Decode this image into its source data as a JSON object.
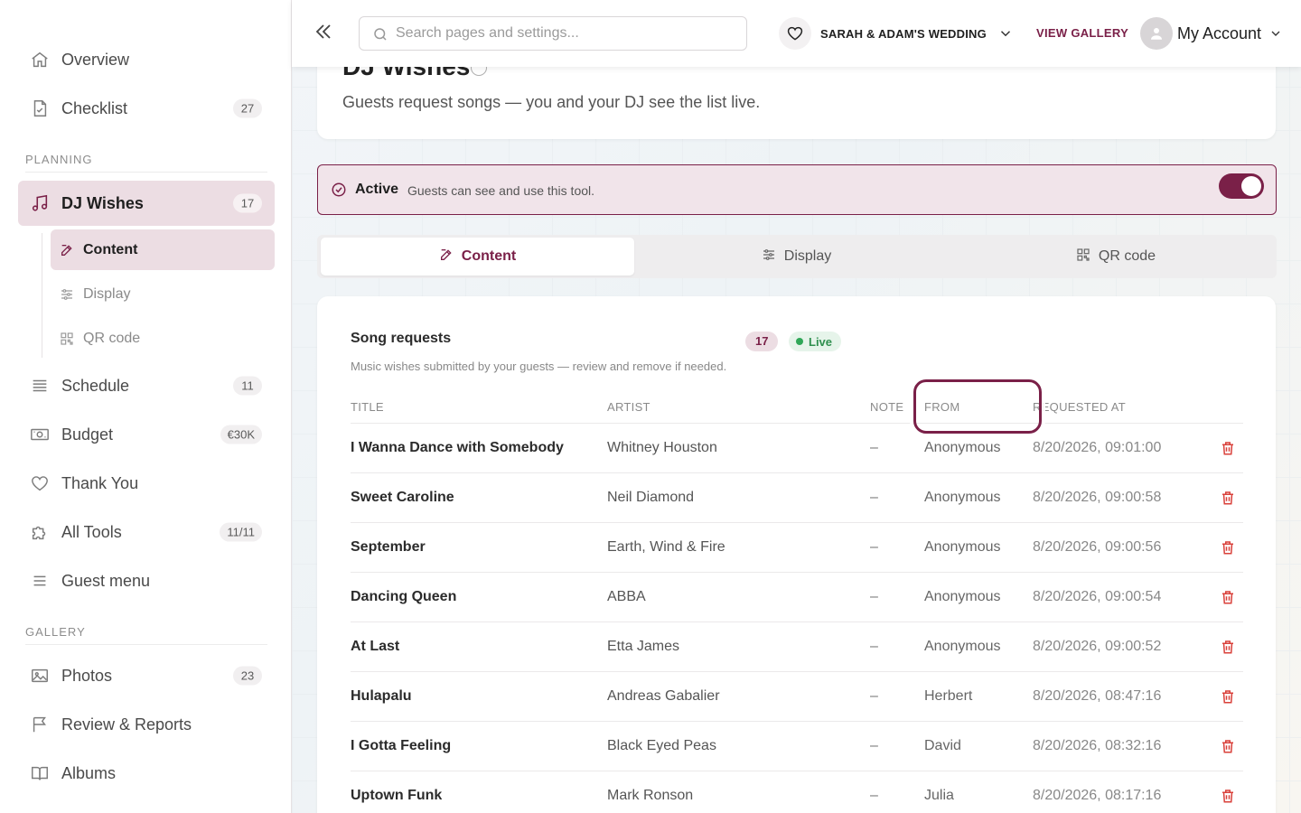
{
  "sidebar": {
    "items_top": [
      {
        "label": "Overview",
        "icon": "home-icon",
        "badge": ""
      },
      {
        "label": "Checklist",
        "icon": "checklist-icon",
        "badge": "27"
      }
    ],
    "planning_label": "PLANNING",
    "dj": {
      "label": "DJ Wishes",
      "icon": "music-note-icon",
      "badge": "17"
    },
    "sub_items": [
      {
        "label": "Content",
        "icon": "edit-icon"
      },
      {
        "label": "Display",
        "icon": "sliders-icon"
      },
      {
        "label": "QR code",
        "icon": "qr-code-icon"
      }
    ],
    "items_mid": [
      {
        "label": "Schedule",
        "icon": "list-icon",
        "badge": "11"
      },
      {
        "label": "Budget",
        "icon": "money-icon",
        "badge": "€30K"
      },
      {
        "label": "Thank You",
        "icon": "heart-icon",
        "badge": ""
      },
      {
        "label": "All Tools",
        "icon": "puzzle-icon",
        "badge": "11/11"
      },
      {
        "label": "Guest menu",
        "icon": "menu-icon",
        "badge": ""
      }
    ],
    "gallery_label": "GALLERY",
    "items_gallery": [
      {
        "label": "Photos",
        "icon": "photo-icon",
        "badge": "23"
      },
      {
        "label": "Review & Reports",
        "icon": "flag-icon",
        "badge": ""
      },
      {
        "label": "Albums",
        "icon": "book-icon",
        "badge": ""
      }
    ]
  },
  "topbar": {
    "search_placeholder": "Search pages and settings...",
    "event_name": "SARAH & ADAM'S WEDDING",
    "view_gallery": "VIEW GALLERY",
    "account": "My Account"
  },
  "header": {
    "title": "DJ Wishes",
    "subtitle": "Guests request songs — you and your DJ see the list live."
  },
  "status": {
    "state": "Active",
    "description": "Guests can see and use this tool.",
    "toggle_on": true
  },
  "tabs": [
    {
      "label": "Content",
      "icon": "edit-icon"
    },
    {
      "label": "Display",
      "icon": "sliders-icon"
    },
    {
      "label": "QR code",
      "icon": "qr-code-icon"
    }
  ],
  "requests": {
    "title": "Song requests",
    "count": "17",
    "live": "Live",
    "description": "Music wishes submitted by your guests — review and remove if needed.",
    "columns": {
      "title": "TITLE",
      "artist": "ARTIST",
      "note": "NOTE",
      "from": "FROM",
      "requested_at": "REQUESTED AT"
    },
    "rows": [
      {
        "title": "I Wanna Dance with Somebody",
        "artist": "Whitney Houston",
        "note": "–",
        "from": "Anonymous",
        "time": "8/20/2026, 09:01:00"
      },
      {
        "title": "Sweet Caroline",
        "artist": "Neil Diamond",
        "note": "–",
        "from": "Anonymous",
        "time": "8/20/2026, 09:00:58"
      },
      {
        "title": "September",
        "artist": "Earth, Wind & Fire",
        "note": "–",
        "from": "Anonymous",
        "time": "8/20/2026, 09:00:56"
      },
      {
        "title": "Dancing Queen",
        "artist": "ABBA",
        "note": "–",
        "from": "Anonymous",
        "time": "8/20/2026, 09:00:54"
      },
      {
        "title": "At Last",
        "artist": "Etta James",
        "note": "–",
        "from": "Anonymous",
        "time": "8/20/2026, 09:00:52"
      },
      {
        "title": "Hulapalu",
        "artist": "Andreas Gabalier",
        "note": "–",
        "from": "Herbert",
        "time": "8/20/2026, 08:47:16"
      },
      {
        "title": "I Gotta Feeling",
        "artist": "Black Eyed Peas",
        "note": "–",
        "from": "David",
        "time": "8/20/2026, 08:32:16"
      },
      {
        "title": "Uptown Funk",
        "artist": "Mark Ronson",
        "note": "–",
        "from": "Julia",
        "time": "8/20/2026, 08:17:16"
      }
    ]
  },
  "colors": {
    "accent": "#7a2048",
    "accent_soft": "#ecdde3",
    "live_green": "#2fa757",
    "delete_red": "#d9403a"
  }
}
